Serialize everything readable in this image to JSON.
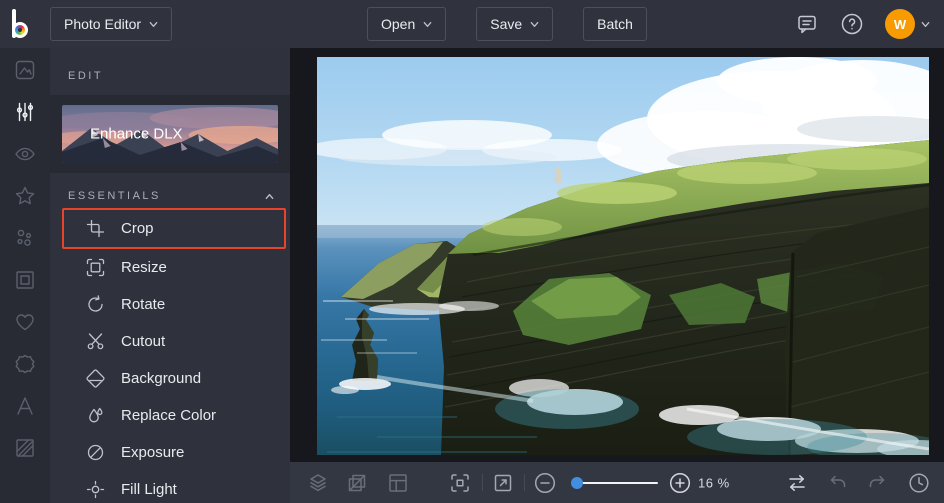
{
  "topbar": {
    "app_menu_label": "Photo Editor",
    "open_label": "Open",
    "save_label": "Save",
    "batch_label": "Batch",
    "avatar_initial": "W",
    "icons": [
      "befunky-logo",
      "messages-icon",
      "help-icon",
      "avatar",
      "chevron-down-icon"
    ]
  },
  "sidebar_rail": {
    "active_index": 1,
    "icons": [
      "image-manager-icon",
      "edit-sliders-icon",
      "touch-up-eye-icon",
      "effects-star-icon",
      "artsy-circles-icon",
      "frames-icon",
      "overlays-heart-icon",
      "graphics-badge-icon",
      "text-icon",
      "textures-icon"
    ]
  },
  "edit_panel": {
    "header": "EDIT",
    "banner": {
      "label": "Enhance DLX"
    },
    "section": {
      "title": "ESSENTIALS",
      "collapse_icon": "chevron-up-icon"
    },
    "items": [
      {
        "label": "Crop",
        "icon": "crop-icon",
        "highlighted": true
      },
      {
        "label": "Resize",
        "icon": "resize-icon",
        "highlighted": false
      },
      {
        "label": "Rotate",
        "icon": "rotate-icon",
        "highlighted": false
      },
      {
        "label": "Cutout",
        "icon": "cutout-icon",
        "highlighted": false
      },
      {
        "label": "Background",
        "icon": "background-icon",
        "highlighted": false
      },
      {
        "label": "Replace Color",
        "icon": "replace-color-icon",
        "highlighted": false
      },
      {
        "label": "Exposure",
        "icon": "exposure-icon",
        "highlighted": false
      },
      {
        "label": "Fill Light",
        "icon": "fill-light-icon",
        "highlighted": false
      }
    ]
  },
  "canvas": {
    "content": "coastal-cliffs-photo"
  },
  "bottom_toolbar": {
    "zoom_label": "16 %",
    "icons_left": [
      "layers-icon",
      "canvas-transform-icon",
      "layout-icon",
      "fit-to-screen-icon",
      "open-in-new-icon"
    ],
    "zoom_controls": [
      "zoom-out-icon",
      "zoom-slider",
      "zoom-in-icon"
    ],
    "icons_right": [
      "compare-icon",
      "undo-icon",
      "redo-icon",
      "history-icon"
    ]
  },
  "colors": {
    "highlight_red": "#e8432b",
    "avatar_orange": "#f89a02",
    "slider_blue": "#418fde",
    "topbar_bg": "#30333d",
    "panel_bg": "#2f323c",
    "canvas_bg": "#17181d"
  }
}
